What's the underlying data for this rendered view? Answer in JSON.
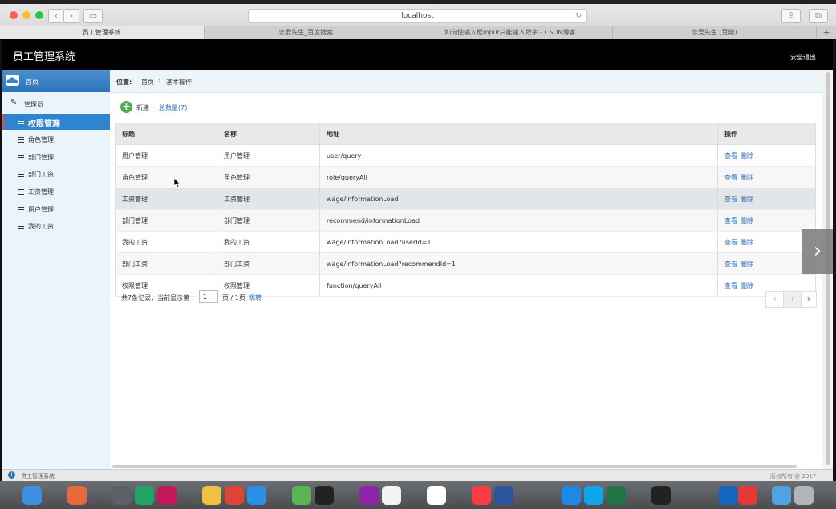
{
  "browser": {
    "address": "localhost",
    "tabs": [
      "员工管理系统",
      "恋爱先生_百度搜索",
      "如何使输入框input只能输入数字 - CSDN博客",
      "恋爱先生 (豆瓣)"
    ],
    "tab_plus": "+"
  },
  "app": {
    "title": "员工管理系统",
    "logout": "安全退出"
  },
  "sidebar": {
    "home": "首页",
    "admin": "管理员",
    "items": [
      "权限管理",
      "角色管理",
      "部门管理",
      "部门工资",
      "工资管理",
      "用户管理",
      "我的工资"
    ]
  },
  "breadcrumb": {
    "prefix": "位置:",
    "home": "首页",
    "sep": "›",
    "current": "基本操作"
  },
  "toolbar": {
    "new_label": "新建",
    "total_label": "总数量(7)"
  },
  "table": {
    "headers": [
      "标题",
      "名称",
      "地址",
      "操作"
    ],
    "rows": [
      {
        "title": "用户管理",
        "name": "用户管理",
        "url": "user/query"
      },
      {
        "title": "角色管理",
        "name": "角色管理",
        "url": "role/queryAll"
      },
      {
        "title": "工资管理",
        "name": "工资管理",
        "url": "wage/informationLoad"
      },
      {
        "title": "部门管理",
        "name": "部门管理",
        "url": "recommend/informationLoad"
      },
      {
        "title": "我的工资",
        "name": "我的工资",
        "url": "wage/informationLoad?userId=1"
      },
      {
        "title": "部门工资",
        "name": "部门工资",
        "url": "wage/informationLoad?recommendId=1"
      },
      {
        "title": "权限管理",
        "name": "权限管理",
        "url": "function/queryAll"
      }
    ],
    "view_label": "查看",
    "delete_label": "删除"
  },
  "pager": {
    "summary": "共7条记录，当前显示第",
    "page_value": "1",
    "of_pages": "页 / 1页",
    "jump": "跳转",
    "current_page": "1",
    "prev": "‹",
    "next": "›"
  },
  "status": {
    "left": "员工管理系统",
    "right": "版权所有 @ 2017"
  },
  "colors": {
    "header_bg": "#000000",
    "sidebar_active": "#2f84cf",
    "link": "#2a6fb9"
  }
}
